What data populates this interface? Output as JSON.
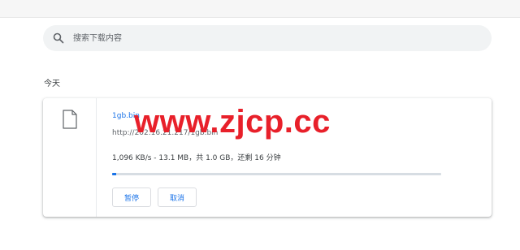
{
  "search": {
    "placeholder": "搜索下载内容"
  },
  "section": {
    "date_label": "今天"
  },
  "download": {
    "file_name": "1gb.bin",
    "url": "http://202.16.21.217/1gb.bin",
    "status": "1,096 KB/s - 13.1 MB，共 1.0 GB，还剩 16 分钟",
    "progress": 0.013,
    "pause_label": "暂停",
    "cancel_label": "取消"
  },
  "watermark": {
    "text": "www.zjcp.cc"
  },
  "colors": {
    "accent": "#1a73e8",
    "watermark": "#e8202a"
  }
}
